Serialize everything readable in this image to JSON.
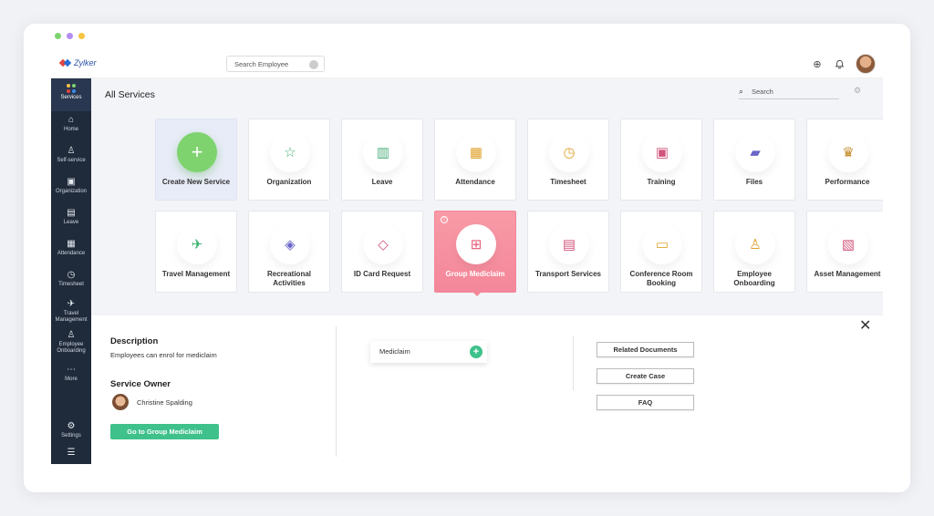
{
  "window": {
    "dots": [
      "#7ed36f",
      "#b58cf0",
      "#f5c542"
    ]
  },
  "brand": {
    "name": "Zylker"
  },
  "topbar": {
    "search_placeholder": "Search Employee",
    "icons": [
      "add-circle-icon",
      "bell-icon",
      "user-avatar"
    ]
  },
  "sidebar": {
    "items": [
      {
        "label": "Services",
        "icon": "apps-grid-icon"
      },
      {
        "label": "Home",
        "icon": "home-icon"
      },
      {
        "label": "Self-service",
        "icon": "user-icon"
      },
      {
        "label": "Organization",
        "icon": "building-icon"
      },
      {
        "label": "Leave",
        "icon": "calendar-icon"
      },
      {
        "label": "Attendance",
        "icon": "calendar-check-icon"
      },
      {
        "label": "Timesheet",
        "icon": "clock-icon"
      },
      {
        "label": "Travel Management",
        "icon": "plane-icon"
      },
      {
        "label": "Employee Onboarding",
        "icon": "onboarding-icon"
      },
      {
        "label": "More",
        "icon": "more-icon"
      },
      {
        "label": "Settings",
        "icon": "gear-icon"
      }
    ]
  },
  "main": {
    "title": "All Services",
    "search_placeholder": "Search"
  },
  "tiles": [
    {
      "label": "Create New Service",
      "icon": "plus-icon"
    },
    {
      "label": "Organization",
      "icon": "star-icon"
    },
    {
      "label": "Leave",
      "icon": "gift-icon"
    },
    {
      "label": "Attendance",
      "icon": "calendar-icon"
    },
    {
      "label": "Timesheet",
      "icon": "alarm-clock-icon"
    },
    {
      "label": "Training",
      "icon": "training-icon"
    },
    {
      "label": "Files",
      "icon": "folder-icon"
    },
    {
      "label": "Performance",
      "icon": "trophy-icon"
    },
    {
      "label": "Travel Management",
      "icon": "plane-icon"
    },
    {
      "label": "Recreational Activities",
      "icon": "handshake-icon"
    },
    {
      "label": "ID Card Request",
      "icon": "tag-icon"
    },
    {
      "label": "Group Mediclaim",
      "icon": "medical-kit-icon"
    },
    {
      "label": "Transport Services",
      "icon": "bus-icon"
    },
    {
      "label": "Conference Room Booking",
      "icon": "presentation-icon"
    },
    {
      "label": "Employee Onboarding",
      "icon": "person-icon"
    },
    {
      "label": "Asset Management",
      "icon": "asset-icon"
    }
  ],
  "detail": {
    "description_heading": "Description",
    "description_text": "Employees can enrol for mediclaim",
    "owner_heading": "Service Owner",
    "owner_name": "Christine Spalding",
    "go_button": "Go to Group Mediclaim",
    "form_item": "Mediclaim",
    "actions": [
      "Related Documents",
      "Create Case",
      "FAQ"
    ]
  }
}
